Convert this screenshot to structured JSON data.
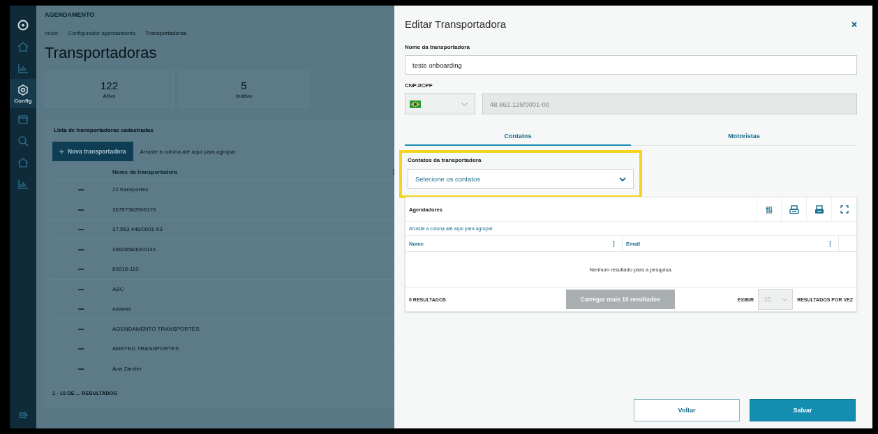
{
  "sidebar": {
    "items": [
      {
        "kind": "logo",
        "selected": false
      },
      {
        "kind": "home",
        "selected": false
      },
      {
        "kind": "chart",
        "selected": false
      },
      {
        "kind": "gear",
        "label": "Config",
        "selected": true
      },
      {
        "kind": "calendar",
        "selected": false
      },
      {
        "kind": "search",
        "selected": false
      },
      {
        "kind": "home",
        "selected": false
      },
      {
        "kind": "chart",
        "selected": false
      }
    ]
  },
  "page": {
    "module": "AGENDAMENTO",
    "breadcrumb": [
      "Início",
      "Configurador agendamento",
      "Transportadoras"
    ],
    "title": "Transportadoras",
    "stats": [
      {
        "value": "122",
        "label": "Ativo"
      },
      {
        "value": "5",
        "label": "Inativo"
      }
    ],
    "list": {
      "title": "Lista de transportadoras cadastradas",
      "new_button": "Nova transportadora",
      "group_hint": "Arraste a coluna até aqui para agrupar",
      "columns": [
        "Nome da transportadora"
      ],
      "rows": [
        {
          "actions": "•••",
          "name": "22 transportes"
        },
        {
          "actions": "•••",
          "name": "36757362000179"
        },
        {
          "actions": "•••",
          "name": "37.553.446/0001-53"
        },
        {
          "actions": "•••",
          "name": "46628584000145"
        },
        {
          "actions": "•••",
          "name": "89216-110"
        },
        {
          "actions": "•••",
          "name": "ABC"
        },
        {
          "actions": "•••",
          "name": "aaaaaa"
        },
        {
          "actions": "•••",
          "name": "AGENDAMENTO TRANSPORTES"
        },
        {
          "actions": "•••",
          "name": "AMSTED TRANSPORTES"
        },
        {
          "actions": "•••",
          "name": "Ana Zander"
        }
      ],
      "footer": "1 - 10 DE ... RESULTADOS"
    }
  },
  "drawer": {
    "title": "Editar Transportadora",
    "name_field": {
      "label": "Nome da transportadora",
      "value": "teste onboarding"
    },
    "document_field": {
      "label": "CNPJ/CPF",
      "value": "48.862.126/0001-00",
      "disabled": true
    },
    "tabs": [
      {
        "label": "Contatos",
        "selected": true
      },
      {
        "label": "Motoristas",
        "selected": false
      }
    ],
    "contacts_field": {
      "label": "Contatos da transportadora",
      "placeholder": "Selecione os contatos",
      "highlighted": true
    },
    "grid": {
      "title": "Agendadores",
      "group_hint": "Arraste a coluna até aqui para agrupar",
      "columns": [
        "Nome",
        "Email"
      ],
      "empty": "Nenhum resultado para a pesquisa.",
      "count": "0 RESULTADOS",
      "load_more": "Carregar mais 10 resultados",
      "show_label": "EXIBIR",
      "page_size": "10",
      "per_page_label": "RESULTADOS POR VEZ"
    },
    "buttons": [
      {
        "kind": "secondary",
        "label": "Voltar"
      },
      {
        "kind": "primary",
        "label": "Salvar"
      }
    ]
  }
}
